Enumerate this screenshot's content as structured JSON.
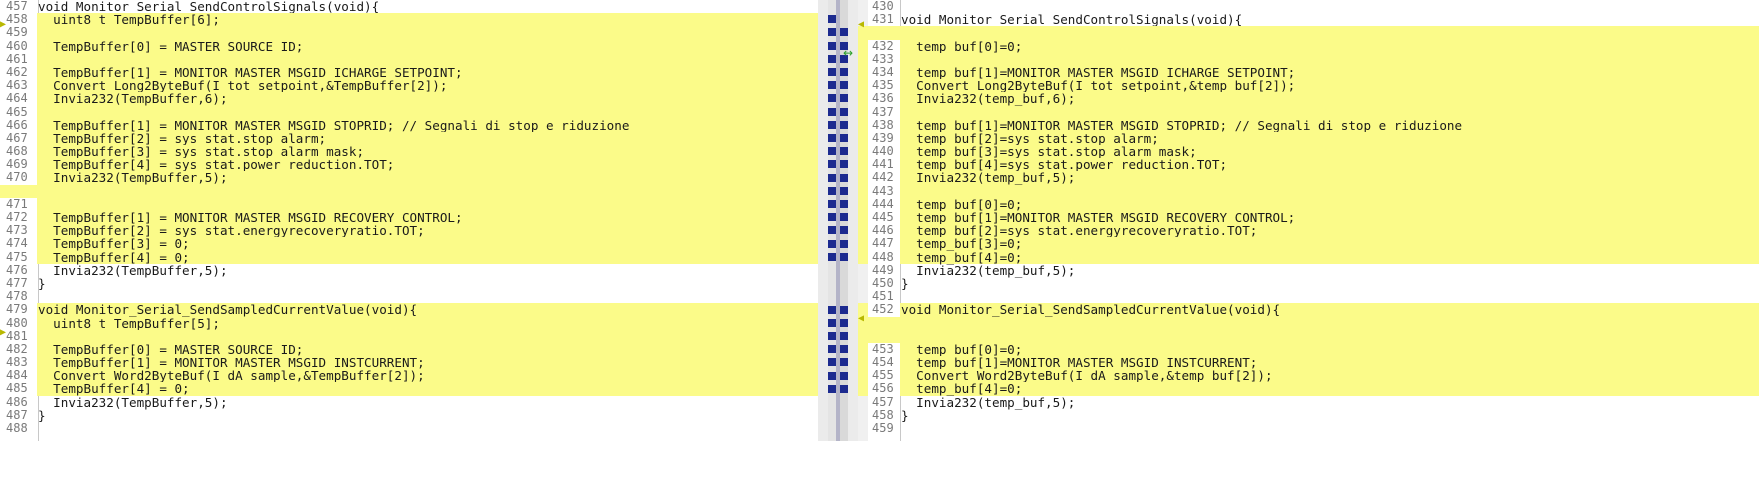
{
  "left": {
    "lines": [
      {
        "n": "457",
        "t": "void Monitor_Serial_SendControlSignals(void){",
        "diff": false
      },
      {
        "n": "458",
        "t": "  uint8_t TempBuffer[6];",
        "diff": true
      },
      {
        "n": "459",
        "t": "",
        "diff": true
      },
      {
        "n": "460",
        "t": "  TempBuffer[0] = MASTER_SOURCE_ID;",
        "diff": true
      },
      {
        "n": "461",
        "t": "",
        "diff": true
      },
      {
        "n": "462",
        "t": "  TempBuffer[1] = MONITOR_MASTER_MSGID_ICHARGE_SETPOINT;",
        "diff": true
      },
      {
        "n": "463",
        "t": "  Convert_Long2ByteBuf(I_tot_setpoint,&TempBuffer[2]);",
        "diff": true
      },
      {
        "n": "464",
        "t": "  Invia232(TempBuffer,6);",
        "diff": true
      },
      {
        "n": "465",
        "t": "",
        "diff": true
      },
      {
        "n": "466",
        "t": "  TempBuffer[1] = MONITOR_MASTER_MSGID_STOPRID; // Segnali di stop e riduzione",
        "diff": true
      },
      {
        "n": "467",
        "t": "  TempBuffer[2] = sys_stat.stop_alarm;",
        "diff": true
      },
      {
        "n": "468",
        "t": "  TempBuffer[3] = sys_stat.stop_alarm_mask;",
        "diff": true
      },
      {
        "n": "469",
        "t": "  TempBuffer[4] = sys_stat.power_reduction.TOT;",
        "diff": true
      },
      {
        "n": "470",
        "t": "  Invia232(TempBuffer,5);",
        "diff": true
      },
      {
        "n": "",
        "t": "",
        "diff": true
      },
      {
        "n": "471",
        "t": "",
        "diff": true
      },
      {
        "n": "472",
        "t": "  TempBuffer[1] = MONITOR_MASTER_MSGID_RECOVERY_CONTROL;",
        "diff": true
      },
      {
        "n": "473",
        "t": "  TempBuffer[2] = sys_stat.energyrecoveryratio.TOT;",
        "diff": true
      },
      {
        "n": "474",
        "t": "  TempBuffer[3] = 0;",
        "diff": true
      },
      {
        "n": "475",
        "t": "  TempBuffer[4] = 0;",
        "diff": true
      },
      {
        "n": "476",
        "t": "  Invia232(TempBuffer,5);",
        "diff": false
      },
      {
        "n": "477",
        "t": "}",
        "diff": false
      },
      {
        "n": "478",
        "t": "",
        "diff": false
      },
      {
        "n": "479",
        "t": "void Monitor_Serial_SendSampledCurrentValue(void){",
        "diff": true
      },
      {
        "n": "480",
        "t": "  uint8_t TempBuffer[5];",
        "diff": true
      },
      {
        "n": "481",
        "t": "",
        "diff": true
      },
      {
        "n": "482",
        "t": "  TempBuffer[0] = MASTER_SOURCE_ID;",
        "diff": true
      },
      {
        "n": "483",
        "t": "  TempBuffer[1] = MONITOR_MASTER_MSGID_INSTCURRENT;",
        "diff": true
      },
      {
        "n": "484",
        "t": "  Convert_Word2ByteBuf(I_dA_sample,&TempBuffer[2]);",
        "diff": true
      },
      {
        "n": "485",
        "t": "  TempBuffer[4] = 0;",
        "diff": true
      },
      {
        "n": "486",
        "t": "  Invia232(TempBuffer,5);",
        "diff": false
      },
      {
        "n": "487",
        "t": "}",
        "diff": false
      },
      {
        "n": "488",
        "t": "",
        "diff": false
      }
    ]
  },
  "right": {
    "lines": [
      {
        "n": "430",
        "t": "",
        "diff": false
      },
      {
        "n": "431",
        "t": "void Monitor_Serial_SendControlSignals(void){",
        "diff": false
      },
      {
        "n": "",
        "t": "",
        "diff": true
      },
      {
        "n": "432",
        "t": "  temp_buf[0]=0;",
        "diff": true
      },
      {
        "n": "433",
        "t": "",
        "diff": true
      },
      {
        "n": "434",
        "t": "  temp_buf[1]=MONITOR_MASTER_MSGID_ICHARGE_SETPOINT;",
        "diff": true
      },
      {
        "n": "435",
        "t": "  Convert_Long2ByteBuf(I_tot_setpoint,&temp_buf[2]);",
        "diff": true
      },
      {
        "n": "436",
        "t": "  Invia232(temp_buf,6);",
        "diff": true
      },
      {
        "n": "437",
        "t": "",
        "diff": true
      },
      {
        "n": "438",
        "t": "  temp_buf[1]=MONITOR_MASTER_MSGID_STOPRID; // Segnali di stop e riduzione",
        "diff": true
      },
      {
        "n": "439",
        "t": "  temp_buf[2]=sys_stat.stop_alarm;",
        "diff": true
      },
      {
        "n": "440",
        "t": "  temp_buf[3]=sys_stat.stop_alarm_mask;",
        "diff": true
      },
      {
        "n": "441",
        "t": "  temp_buf[4]=sys_stat.power_reduction.TOT;",
        "diff": true
      },
      {
        "n": "442",
        "t": "  Invia232(temp_buf,5);",
        "diff": true
      },
      {
        "n": "443",
        "t": "",
        "diff": true
      },
      {
        "n": "444",
        "t": "  temp_buf[0]=0;",
        "diff": true
      },
      {
        "n": "445",
        "t": "  temp_buf[1]=MONITOR_MASTER_MSGID_RECOVERY_CONTROL;",
        "diff": true
      },
      {
        "n": "446",
        "t": "  temp_buf[2]=sys_stat.energyrecoveryratio.TOT;",
        "diff": true
      },
      {
        "n": "447",
        "t": "  temp_buf[3]=0;",
        "diff": true
      },
      {
        "n": "448",
        "t": "  temp_buf[4]=0;",
        "diff": true
      },
      {
        "n": "449",
        "t": "  Invia232(temp_buf,5);",
        "diff": false
      },
      {
        "n": "450",
        "t": "}",
        "diff": false
      },
      {
        "n": "451",
        "t": "",
        "diff": false
      },
      {
        "n": "452",
        "t": "void Monitor_Serial_SendSampledCurrentValue(void){",
        "diff": true
      },
      {
        "n": "",
        "t": "",
        "diff": true
      },
      {
        "n": "",
        "t": "",
        "diff": true
      },
      {
        "n": "453",
        "t": "  temp_buf[0]=0;",
        "diff": true
      },
      {
        "n": "454",
        "t": "  temp_buf[1]=MONITOR_MASTER_MSGID_INSTCURRENT;",
        "diff": true
      },
      {
        "n": "455",
        "t": "  Convert_Word2ByteBuf(I_dA_sample,&temp_buf[2]);",
        "diff": true
      },
      {
        "n": "456",
        "t": "  temp_buf[4]=0;",
        "diff": true
      },
      {
        "n": "457",
        "t": "  Invia232(temp_buf,5);",
        "diff": false
      },
      {
        "n": "458",
        "t": "}",
        "diff": false
      },
      {
        "n": "459",
        "t": "",
        "diff": false
      }
    ]
  },
  "colors": {
    "diff_background": "#fbfb89",
    "overview_mark": "#1c2a8f",
    "sync_arrow": "#2aa02a",
    "arrow_marker": "#c8c800"
  },
  "icons": {
    "sync": "↔",
    "left_arrow": "▶",
    "right_arrow": "◀"
  }
}
